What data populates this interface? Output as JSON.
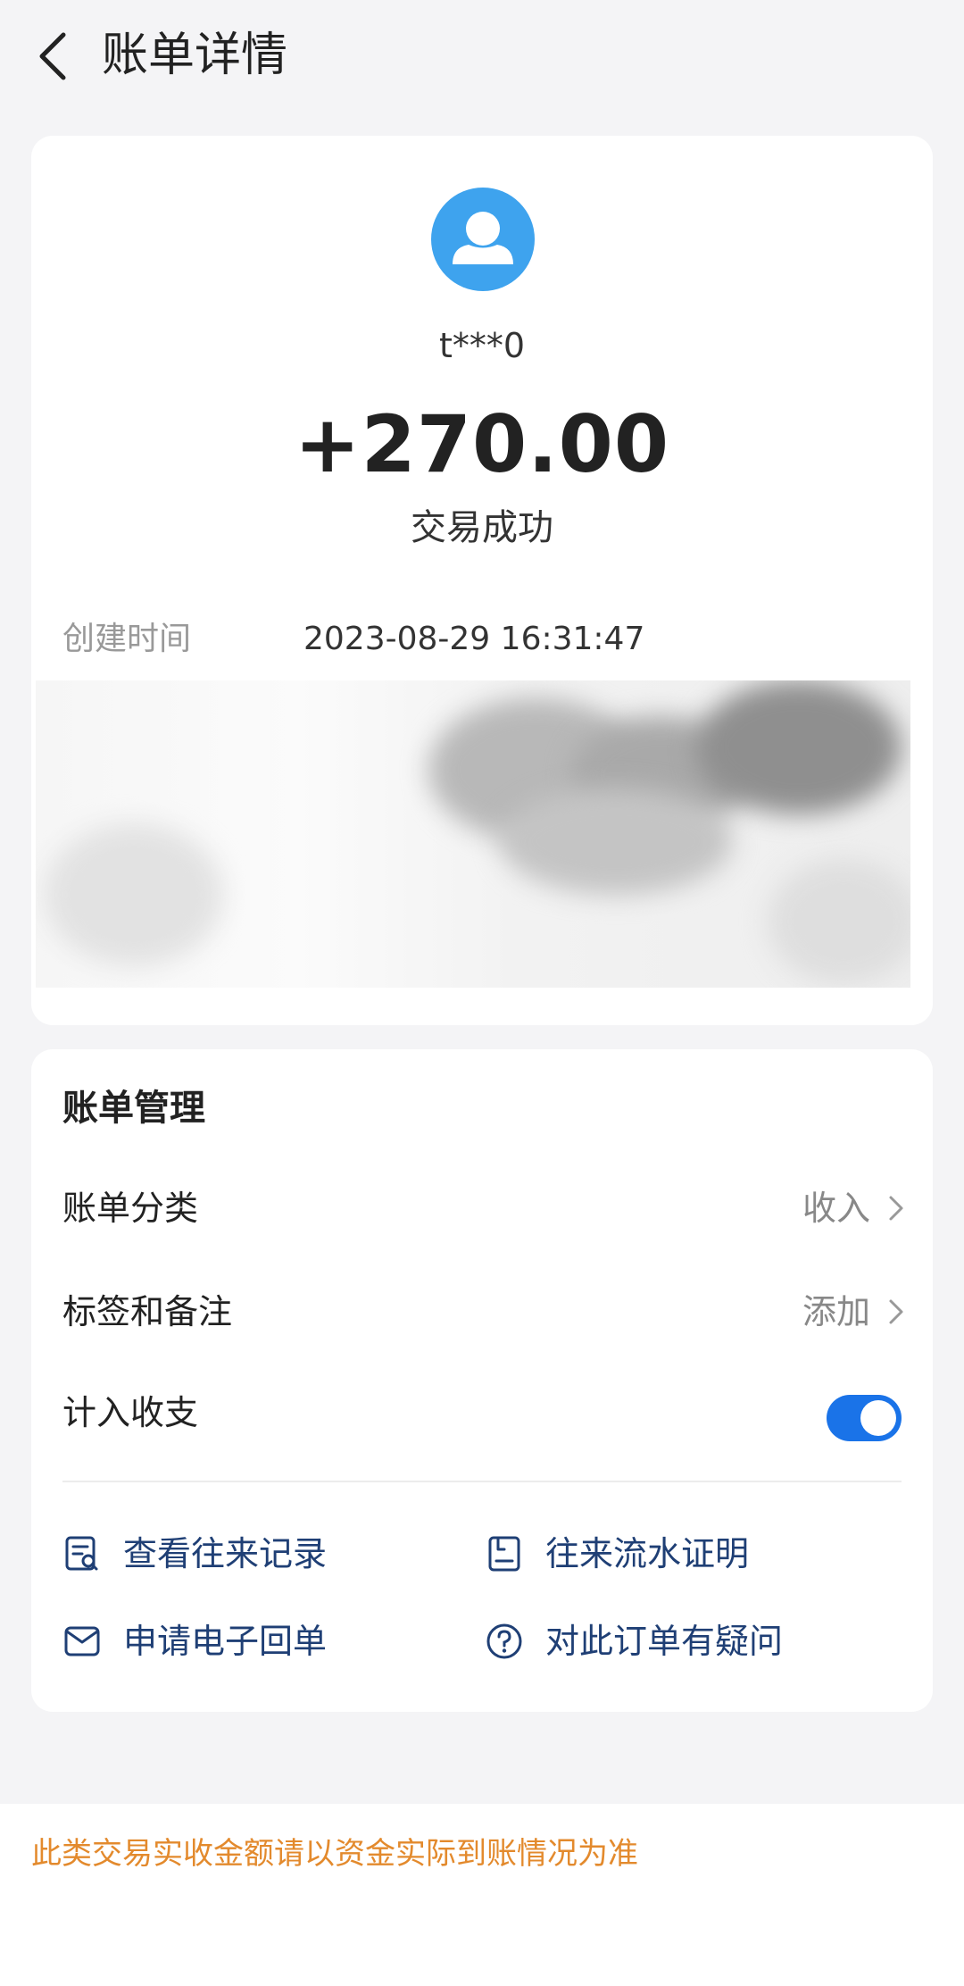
{
  "header": {
    "title": "账单详情",
    "back_icon": "chevron-left-icon"
  },
  "transaction": {
    "avatar_icon": "user-icon",
    "avatar_color": "#3ea3ee",
    "counterparty": "t***0",
    "amount": "+270.00",
    "status": "交易成功",
    "created_label": "创建时间",
    "created_value": "2023-08-29 16:31:47"
  },
  "management": {
    "title": "账单管理",
    "category": {
      "label": "账单分类",
      "value": "收入"
    },
    "tags": {
      "label": "标签和备注",
      "value": "添加"
    },
    "include": {
      "label": "计入收支",
      "enabled": true
    },
    "actions": [
      {
        "label": "查看往来记录",
        "icon": "record-search-icon"
      },
      {
        "label": "往来流水证明",
        "icon": "statement-icon"
      },
      {
        "label": "申请电子回单",
        "icon": "mail-icon"
      },
      {
        "label": "对此订单有疑问",
        "icon": "question-icon"
      }
    ]
  },
  "footer": {
    "note": "此类交易实收金额请以资金实际到账情况为准"
  },
  "colors": {
    "accent": "#1a73e8",
    "action_text": "#1f3f75",
    "warning_text": "#e38a2d"
  }
}
